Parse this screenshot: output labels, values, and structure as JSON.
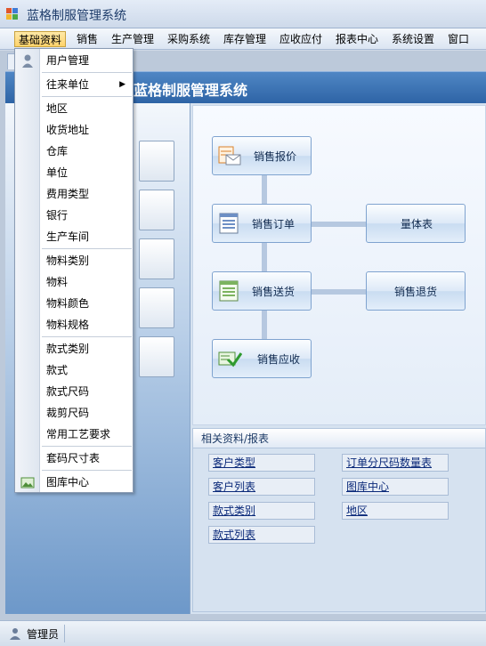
{
  "window": {
    "title": "蓝格制服管理系统"
  },
  "menubar": {
    "items": [
      {
        "label": "基础资料"
      },
      {
        "label": "销售"
      },
      {
        "label": "生产管理"
      },
      {
        "label": "采购系统"
      },
      {
        "label": "库存管理"
      },
      {
        "label": "应收应付"
      },
      {
        "label": "报表中心"
      },
      {
        "label": "系统设置"
      },
      {
        "label": "窗口"
      }
    ]
  },
  "header": {
    "title": "蓝格制服管理系统"
  },
  "dropdown": {
    "items": [
      {
        "label": "用户管理",
        "icon": "user-icon"
      },
      {
        "label": "往来单位",
        "submenu": true
      },
      {
        "label": "地区"
      },
      {
        "label": "收货地址"
      },
      {
        "label": "仓库"
      },
      {
        "label": "单位"
      },
      {
        "label": "费用类型"
      },
      {
        "label": "银行"
      },
      {
        "label": "生产车间"
      },
      {
        "label": "物料类别"
      },
      {
        "label": "物料"
      },
      {
        "label": "物料颜色"
      },
      {
        "label": "物料规格"
      },
      {
        "label": "款式类别"
      },
      {
        "label": "款式"
      },
      {
        "label": "款式尺码"
      },
      {
        "label": "裁剪尺码"
      },
      {
        "label": "常用工艺要求"
      },
      {
        "label": "套码尺寸表"
      },
      {
        "label": "图库中心",
        "icon": "image-icon"
      }
    ],
    "arrow": "▶"
  },
  "flow": {
    "quote": "销售报价",
    "order": "销售订单",
    "measure": "量体表",
    "delivery": "销售送货",
    "return": "销售退货",
    "receivable": "销售应收"
  },
  "related": {
    "title": "相关资料/报表",
    "links": [
      "客户类型",
      "订单分尺码数量表",
      "客户列表",
      "图库中心",
      "款式类别",
      "地区",
      "款式列表"
    ]
  },
  "status": {
    "user": "管理员"
  }
}
